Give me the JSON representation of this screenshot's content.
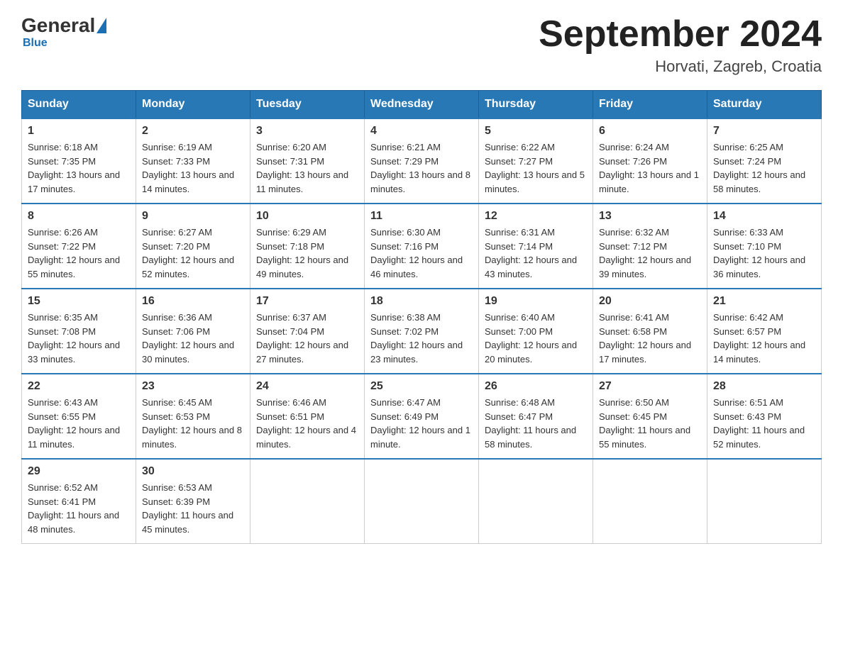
{
  "header": {
    "logo": {
      "general": "General",
      "blue": "Blue"
    },
    "month_title": "September 2024",
    "location": "Horvati, Zagreb, Croatia"
  },
  "days_of_week": [
    "Sunday",
    "Monday",
    "Tuesday",
    "Wednesday",
    "Thursday",
    "Friday",
    "Saturday"
  ],
  "weeks": [
    [
      {
        "day": "1",
        "sunrise": "6:18 AM",
        "sunset": "7:35 PM",
        "daylight": "13 hours and 17 minutes."
      },
      {
        "day": "2",
        "sunrise": "6:19 AM",
        "sunset": "7:33 PM",
        "daylight": "13 hours and 14 minutes."
      },
      {
        "day": "3",
        "sunrise": "6:20 AM",
        "sunset": "7:31 PM",
        "daylight": "13 hours and 11 minutes."
      },
      {
        "day": "4",
        "sunrise": "6:21 AM",
        "sunset": "7:29 PM",
        "daylight": "13 hours and 8 minutes."
      },
      {
        "day": "5",
        "sunrise": "6:22 AM",
        "sunset": "7:27 PM",
        "daylight": "13 hours and 5 minutes."
      },
      {
        "day": "6",
        "sunrise": "6:24 AM",
        "sunset": "7:26 PM",
        "daylight": "13 hours and 1 minute."
      },
      {
        "day": "7",
        "sunrise": "6:25 AM",
        "sunset": "7:24 PM",
        "daylight": "12 hours and 58 minutes."
      }
    ],
    [
      {
        "day": "8",
        "sunrise": "6:26 AM",
        "sunset": "7:22 PM",
        "daylight": "12 hours and 55 minutes."
      },
      {
        "day": "9",
        "sunrise": "6:27 AM",
        "sunset": "7:20 PM",
        "daylight": "12 hours and 52 minutes."
      },
      {
        "day": "10",
        "sunrise": "6:29 AM",
        "sunset": "7:18 PM",
        "daylight": "12 hours and 49 minutes."
      },
      {
        "day": "11",
        "sunrise": "6:30 AM",
        "sunset": "7:16 PM",
        "daylight": "12 hours and 46 minutes."
      },
      {
        "day": "12",
        "sunrise": "6:31 AM",
        "sunset": "7:14 PM",
        "daylight": "12 hours and 43 minutes."
      },
      {
        "day": "13",
        "sunrise": "6:32 AM",
        "sunset": "7:12 PM",
        "daylight": "12 hours and 39 minutes."
      },
      {
        "day": "14",
        "sunrise": "6:33 AM",
        "sunset": "7:10 PM",
        "daylight": "12 hours and 36 minutes."
      }
    ],
    [
      {
        "day": "15",
        "sunrise": "6:35 AM",
        "sunset": "7:08 PM",
        "daylight": "12 hours and 33 minutes."
      },
      {
        "day": "16",
        "sunrise": "6:36 AM",
        "sunset": "7:06 PM",
        "daylight": "12 hours and 30 minutes."
      },
      {
        "day": "17",
        "sunrise": "6:37 AM",
        "sunset": "7:04 PM",
        "daylight": "12 hours and 27 minutes."
      },
      {
        "day": "18",
        "sunrise": "6:38 AM",
        "sunset": "7:02 PM",
        "daylight": "12 hours and 23 minutes."
      },
      {
        "day": "19",
        "sunrise": "6:40 AM",
        "sunset": "7:00 PM",
        "daylight": "12 hours and 20 minutes."
      },
      {
        "day": "20",
        "sunrise": "6:41 AM",
        "sunset": "6:58 PM",
        "daylight": "12 hours and 17 minutes."
      },
      {
        "day": "21",
        "sunrise": "6:42 AM",
        "sunset": "6:57 PM",
        "daylight": "12 hours and 14 minutes."
      }
    ],
    [
      {
        "day": "22",
        "sunrise": "6:43 AM",
        "sunset": "6:55 PM",
        "daylight": "12 hours and 11 minutes."
      },
      {
        "day": "23",
        "sunrise": "6:45 AM",
        "sunset": "6:53 PM",
        "daylight": "12 hours and 8 minutes."
      },
      {
        "day": "24",
        "sunrise": "6:46 AM",
        "sunset": "6:51 PM",
        "daylight": "12 hours and 4 minutes."
      },
      {
        "day": "25",
        "sunrise": "6:47 AM",
        "sunset": "6:49 PM",
        "daylight": "12 hours and 1 minute."
      },
      {
        "day": "26",
        "sunrise": "6:48 AM",
        "sunset": "6:47 PM",
        "daylight": "11 hours and 58 minutes."
      },
      {
        "day": "27",
        "sunrise": "6:50 AM",
        "sunset": "6:45 PM",
        "daylight": "11 hours and 55 minutes."
      },
      {
        "day": "28",
        "sunrise": "6:51 AM",
        "sunset": "6:43 PM",
        "daylight": "11 hours and 52 minutes."
      }
    ],
    [
      {
        "day": "29",
        "sunrise": "6:52 AM",
        "sunset": "6:41 PM",
        "daylight": "11 hours and 48 minutes."
      },
      {
        "day": "30",
        "sunrise": "6:53 AM",
        "sunset": "6:39 PM",
        "daylight": "11 hours and 45 minutes."
      },
      null,
      null,
      null,
      null,
      null
    ]
  ],
  "labels": {
    "sunrise": "Sunrise:",
    "sunset": "Sunset:",
    "daylight": "Daylight:"
  }
}
